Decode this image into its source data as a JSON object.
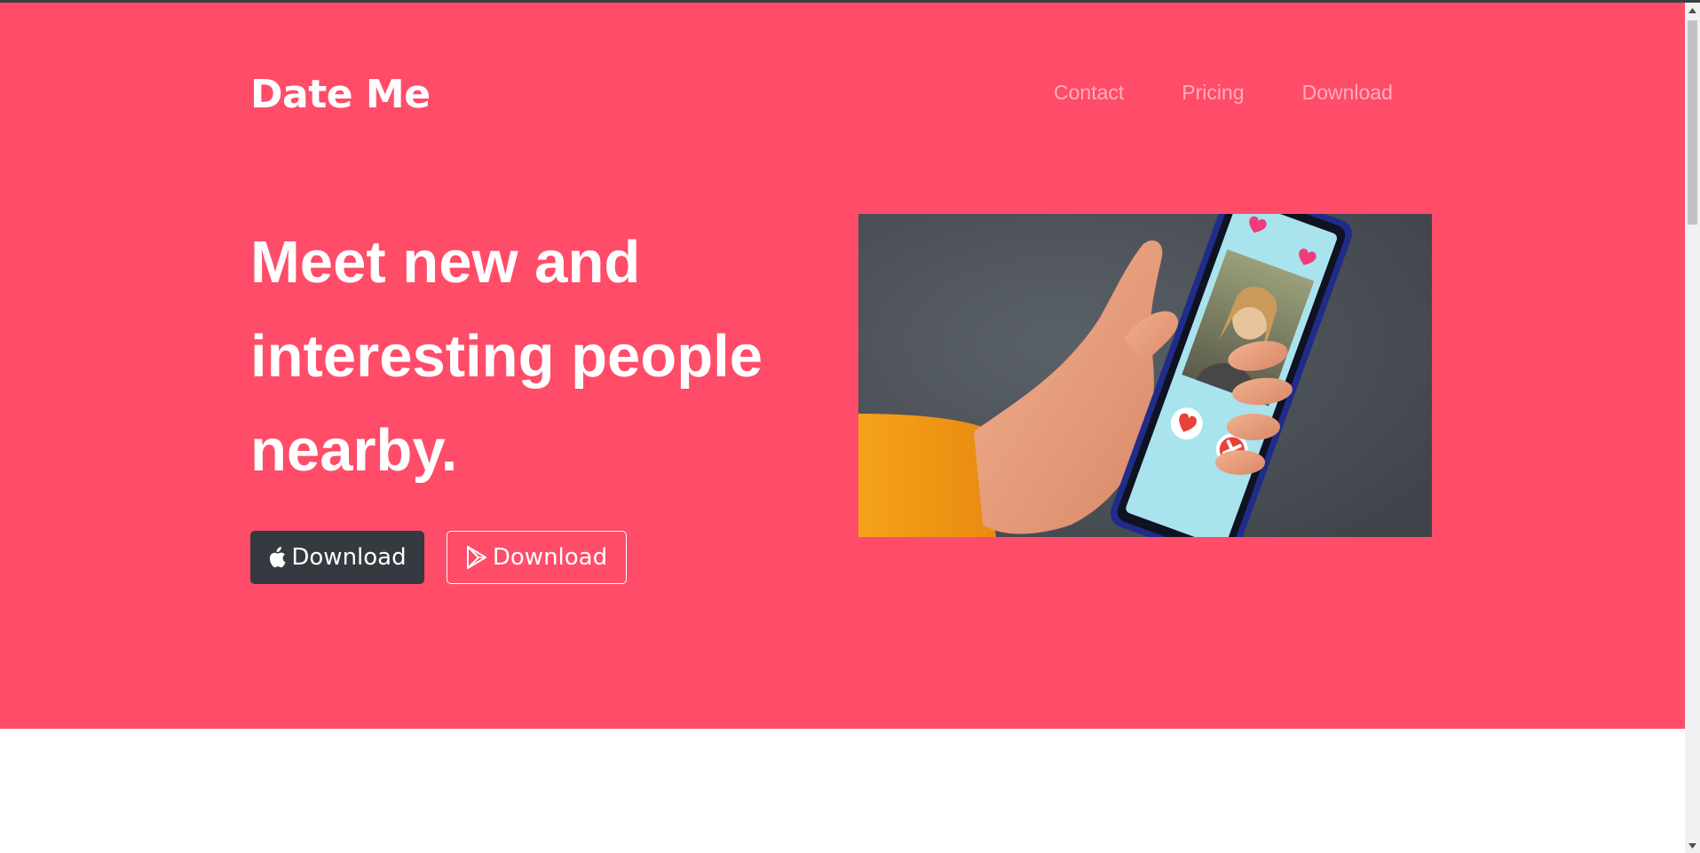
{
  "brand": {
    "name": "Date Me"
  },
  "nav": {
    "items": [
      {
        "label": "Contact"
      },
      {
        "label": "Pricing"
      },
      {
        "label": "Download"
      }
    ]
  },
  "hero": {
    "headline": "Meet new and interesting people nearby.",
    "buttons": {
      "ios_label": "Download",
      "android_label": "Download"
    },
    "image_icon": "phone-dating-app-photo"
  },
  "colors": {
    "hero_bg": "#ff4c68",
    "dark_button": "#343a40",
    "text": "#ffffff"
  }
}
